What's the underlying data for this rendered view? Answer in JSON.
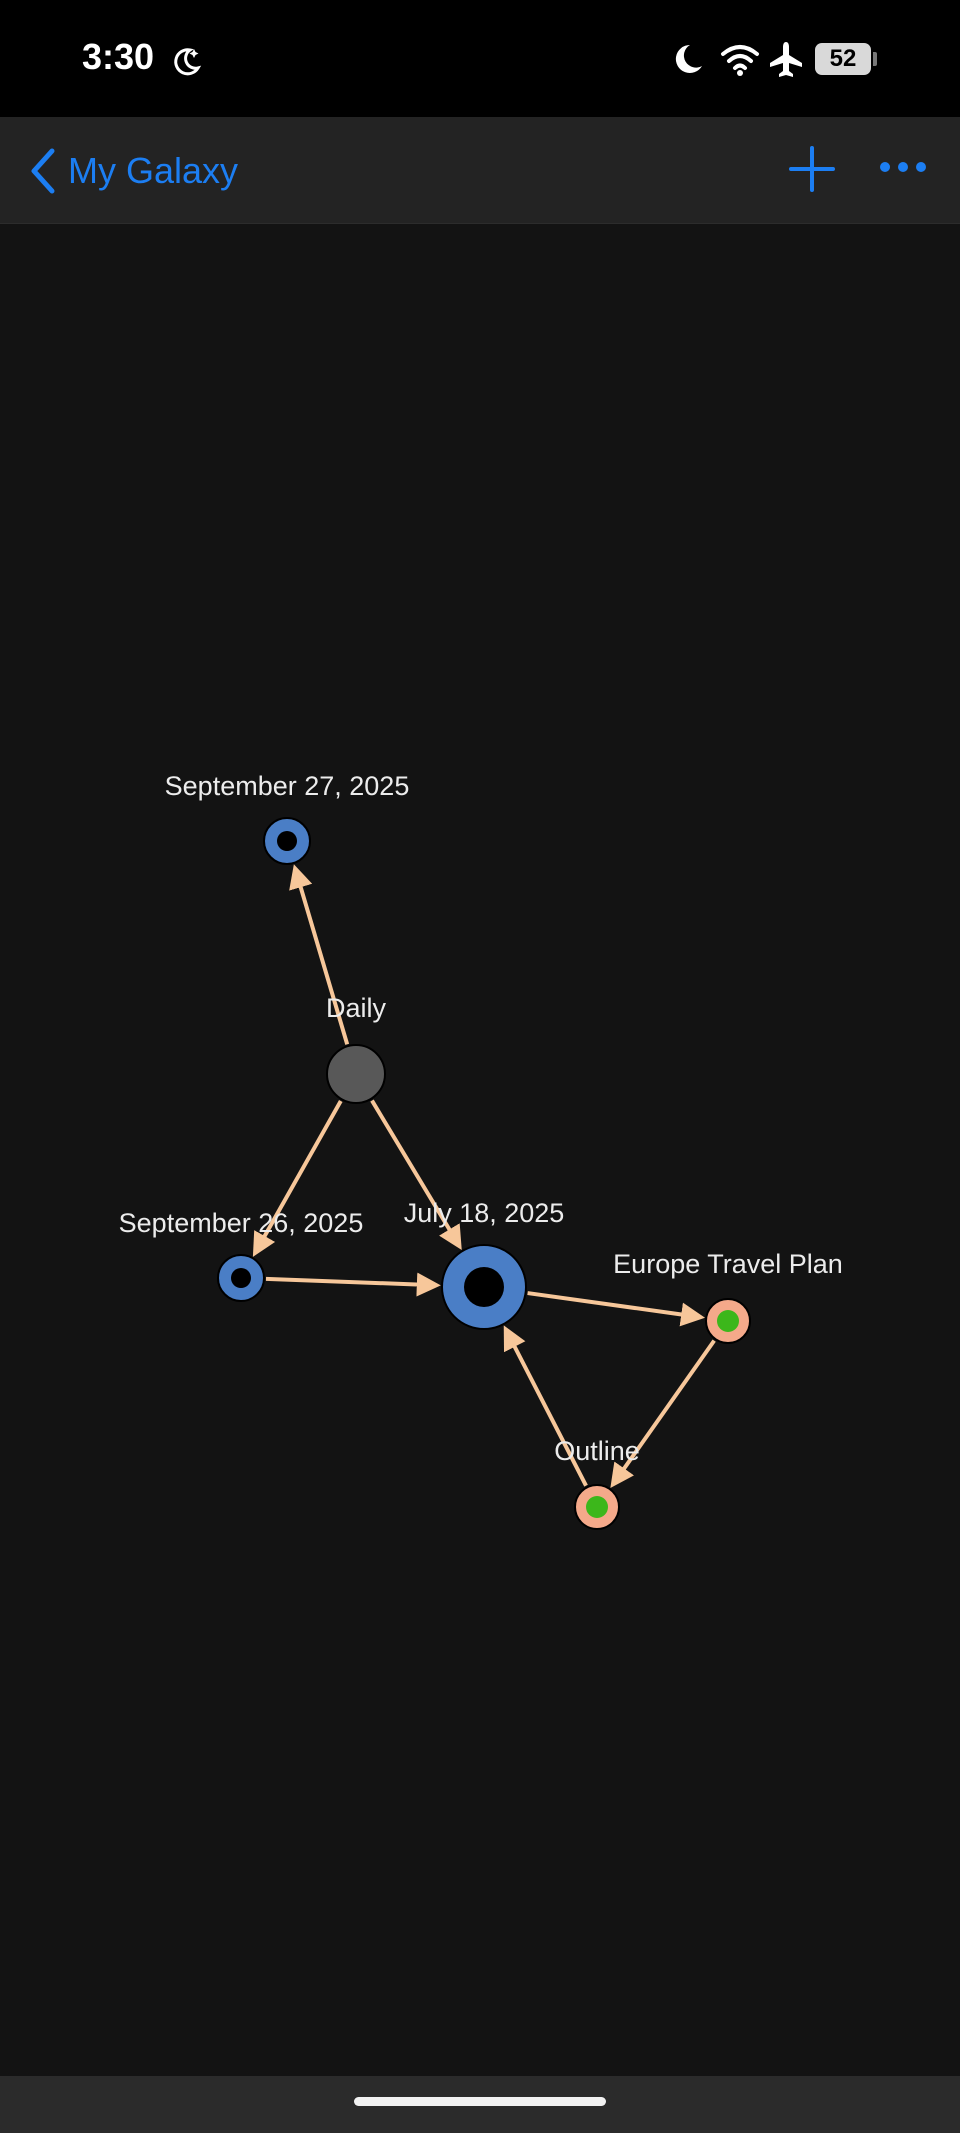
{
  "status_bar": {
    "time": "3:30",
    "battery": "52",
    "icons": [
      "moon-stars-icon",
      "moon-icon",
      "wifi-icon",
      "airplane-icon",
      "battery-icon"
    ]
  },
  "nav": {
    "back_label": "My Galaxy",
    "actions": [
      "plus-icon",
      "more-icon"
    ]
  },
  "colors": {
    "accent": "#1c7ef2",
    "edge": "#f7c79a",
    "journal_node": "#4a7ec6",
    "tag_node": "#585858",
    "doc_node": "#f4a98a",
    "doc_core": "#3cb71b",
    "background": "#131313"
  },
  "graph": {
    "nodes": [
      {
        "id": "sep27",
        "label": "September 27, 2025",
        "kind": "journal"
      },
      {
        "id": "daily",
        "label": "Daily",
        "kind": "tag"
      },
      {
        "id": "sep26",
        "label": "September 26, 2025",
        "kind": "journal"
      },
      {
        "id": "jul18",
        "label": "July 18, 2025",
        "kind": "journal-large"
      },
      {
        "id": "europe",
        "label": "Europe Travel Plan",
        "kind": "document"
      },
      {
        "id": "outline",
        "label": "Outline",
        "kind": "document"
      }
    ],
    "edges": [
      {
        "from": "daily",
        "to": "sep27"
      },
      {
        "from": "daily",
        "to": "sep26"
      },
      {
        "from": "daily",
        "to": "jul18"
      },
      {
        "from": "sep26",
        "to": "jul18"
      },
      {
        "from": "jul18",
        "to": "europe"
      },
      {
        "from": "europe",
        "to": "outline"
      },
      {
        "from": "outline",
        "to": "jul18"
      }
    ]
  }
}
